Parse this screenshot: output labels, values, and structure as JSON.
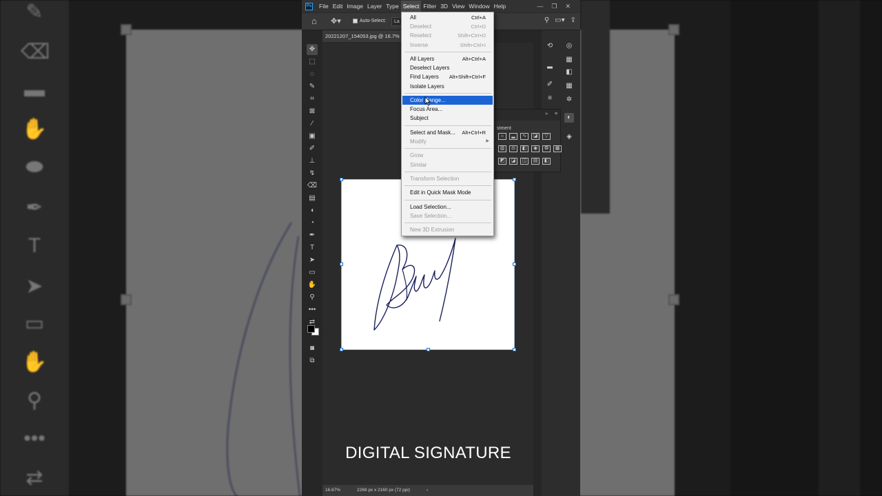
{
  "menubar": {
    "items": [
      "File",
      "Edit",
      "Image",
      "Layer",
      "Type",
      "Select",
      "Filter",
      "3D",
      "View",
      "Window",
      "Help"
    ],
    "active": "Select"
  },
  "options": {
    "auto_select_label": "Auto-Select:",
    "layer_value": "La"
  },
  "document": {
    "tab_title": "20221207_154053.jpg @ 16.7%",
    "status_zoom": "16.67%",
    "status_info": "2268 px x 2160 px (72 ppi)"
  },
  "adjustments": {
    "title": "stment"
  },
  "select_menu": {
    "groups": [
      [
        {
          "label": "All",
          "shortcut": "Ctrl+A",
          "disabled": false
        },
        {
          "label": "Deselect",
          "shortcut": "Ctrl+D",
          "disabled": true
        },
        {
          "label": "Reselect",
          "shortcut": "Shift+Ctrl+D",
          "disabled": true
        },
        {
          "label": "Inverse",
          "shortcut": "Shift+Ctrl+I",
          "disabled": true
        }
      ],
      [
        {
          "label": "All Layers",
          "shortcut": "Alt+Ctrl+A",
          "disabled": false
        },
        {
          "label": "Deselect Layers",
          "shortcut": "",
          "disabled": false
        },
        {
          "label": "Find Layers",
          "shortcut": "Alt+Shift+Ctrl+F",
          "disabled": false
        },
        {
          "label": "Isolate Layers",
          "shortcut": "",
          "disabled": false
        }
      ],
      [
        {
          "label": "Color Range...",
          "shortcut": "",
          "disabled": false,
          "highlighted": true
        },
        {
          "label": "Focus Area...",
          "shortcut": "",
          "disabled": false
        },
        {
          "label": "Subject",
          "shortcut": "",
          "disabled": false
        }
      ],
      [
        {
          "label": "Select and Mask...",
          "shortcut": "Alt+Ctrl+R",
          "disabled": false
        },
        {
          "label": "Modify",
          "shortcut": "",
          "disabled": true,
          "submenu": true
        }
      ],
      [
        {
          "label": "Grow",
          "shortcut": "",
          "disabled": true
        },
        {
          "label": "Similar",
          "shortcut": "",
          "disabled": true
        }
      ],
      [
        {
          "label": "Transform Selection",
          "shortcut": "",
          "disabled": true
        }
      ],
      [
        {
          "label": "Edit in Quick Mask Mode",
          "shortcut": "",
          "disabled": false
        }
      ],
      [
        {
          "label": "Load Selection...",
          "shortcut": "",
          "disabled": false
        },
        {
          "label": "Save Selection...",
          "shortcut": "",
          "disabled": true
        }
      ],
      [
        {
          "label": "New 3D Extrusion",
          "shortcut": "",
          "disabled": true
        }
      ]
    ]
  },
  "caption": "DIGITAL SIGNATURE",
  "colors": {
    "highlight": "#1c64d4",
    "menu_bg": "#f2f2f2",
    "ui_dark": "#262626",
    "ink": "#1a1f5c"
  }
}
